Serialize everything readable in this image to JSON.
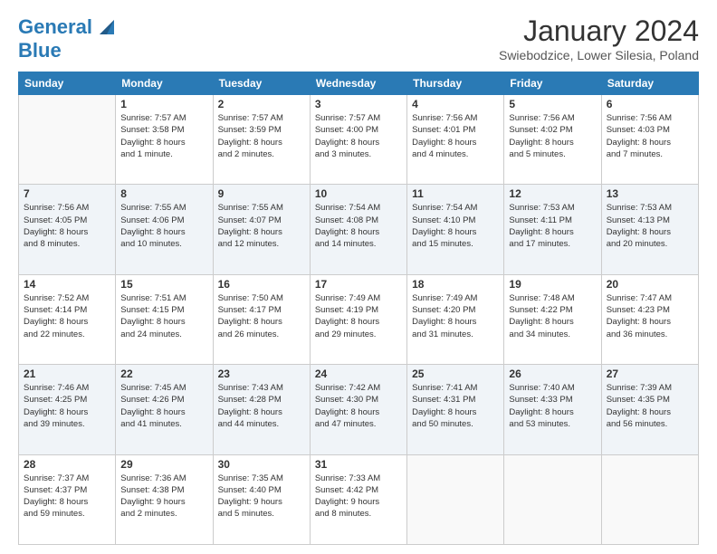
{
  "header": {
    "logo_line1": "General",
    "logo_line2": "Blue",
    "title": "January 2024",
    "subtitle": "Swiebodzice, Lower Silesia, Poland"
  },
  "days_of_week": [
    "Sunday",
    "Monday",
    "Tuesday",
    "Wednesday",
    "Thursday",
    "Friday",
    "Saturday"
  ],
  "weeks": [
    [
      {
        "day": "",
        "info": ""
      },
      {
        "day": "1",
        "info": "Sunrise: 7:57 AM\nSunset: 3:58 PM\nDaylight: 8 hours\nand 1 minute."
      },
      {
        "day": "2",
        "info": "Sunrise: 7:57 AM\nSunset: 3:59 PM\nDaylight: 8 hours\nand 2 minutes."
      },
      {
        "day": "3",
        "info": "Sunrise: 7:57 AM\nSunset: 4:00 PM\nDaylight: 8 hours\nand 3 minutes."
      },
      {
        "day": "4",
        "info": "Sunrise: 7:56 AM\nSunset: 4:01 PM\nDaylight: 8 hours\nand 4 minutes."
      },
      {
        "day": "5",
        "info": "Sunrise: 7:56 AM\nSunset: 4:02 PM\nDaylight: 8 hours\nand 5 minutes."
      },
      {
        "day": "6",
        "info": "Sunrise: 7:56 AM\nSunset: 4:03 PM\nDaylight: 8 hours\nand 7 minutes."
      }
    ],
    [
      {
        "day": "7",
        "info": "Sunrise: 7:56 AM\nSunset: 4:05 PM\nDaylight: 8 hours\nand 8 minutes."
      },
      {
        "day": "8",
        "info": "Sunrise: 7:55 AM\nSunset: 4:06 PM\nDaylight: 8 hours\nand 10 minutes."
      },
      {
        "day": "9",
        "info": "Sunrise: 7:55 AM\nSunset: 4:07 PM\nDaylight: 8 hours\nand 12 minutes."
      },
      {
        "day": "10",
        "info": "Sunrise: 7:54 AM\nSunset: 4:08 PM\nDaylight: 8 hours\nand 14 minutes."
      },
      {
        "day": "11",
        "info": "Sunrise: 7:54 AM\nSunset: 4:10 PM\nDaylight: 8 hours\nand 15 minutes."
      },
      {
        "day": "12",
        "info": "Sunrise: 7:53 AM\nSunset: 4:11 PM\nDaylight: 8 hours\nand 17 minutes."
      },
      {
        "day": "13",
        "info": "Sunrise: 7:53 AM\nSunset: 4:13 PM\nDaylight: 8 hours\nand 20 minutes."
      }
    ],
    [
      {
        "day": "14",
        "info": "Sunrise: 7:52 AM\nSunset: 4:14 PM\nDaylight: 8 hours\nand 22 minutes."
      },
      {
        "day": "15",
        "info": "Sunrise: 7:51 AM\nSunset: 4:15 PM\nDaylight: 8 hours\nand 24 minutes."
      },
      {
        "day": "16",
        "info": "Sunrise: 7:50 AM\nSunset: 4:17 PM\nDaylight: 8 hours\nand 26 minutes."
      },
      {
        "day": "17",
        "info": "Sunrise: 7:49 AM\nSunset: 4:19 PM\nDaylight: 8 hours\nand 29 minutes."
      },
      {
        "day": "18",
        "info": "Sunrise: 7:49 AM\nSunset: 4:20 PM\nDaylight: 8 hours\nand 31 minutes."
      },
      {
        "day": "19",
        "info": "Sunrise: 7:48 AM\nSunset: 4:22 PM\nDaylight: 8 hours\nand 34 minutes."
      },
      {
        "day": "20",
        "info": "Sunrise: 7:47 AM\nSunset: 4:23 PM\nDaylight: 8 hours\nand 36 minutes."
      }
    ],
    [
      {
        "day": "21",
        "info": "Sunrise: 7:46 AM\nSunset: 4:25 PM\nDaylight: 8 hours\nand 39 minutes."
      },
      {
        "day": "22",
        "info": "Sunrise: 7:45 AM\nSunset: 4:26 PM\nDaylight: 8 hours\nand 41 minutes."
      },
      {
        "day": "23",
        "info": "Sunrise: 7:43 AM\nSunset: 4:28 PM\nDaylight: 8 hours\nand 44 minutes."
      },
      {
        "day": "24",
        "info": "Sunrise: 7:42 AM\nSunset: 4:30 PM\nDaylight: 8 hours\nand 47 minutes."
      },
      {
        "day": "25",
        "info": "Sunrise: 7:41 AM\nSunset: 4:31 PM\nDaylight: 8 hours\nand 50 minutes."
      },
      {
        "day": "26",
        "info": "Sunrise: 7:40 AM\nSunset: 4:33 PM\nDaylight: 8 hours\nand 53 minutes."
      },
      {
        "day": "27",
        "info": "Sunrise: 7:39 AM\nSunset: 4:35 PM\nDaylight: 8 hours\nand 56 minutes."
      }
    ],
    [
      {
        "day": "28",
        "info": "Sunrise: 7:37 AM\nSunset: 4:37 PM\nDaylight: 8 hours\nand 59 minutes."
      },
      {
        "day": "29",
        "info": "Sunrise: 7:36 AM\nSunset: 4:38 PM\nDaylight: 9 hours\nand 2 minutes."
      },
      {
        "day": "30",
        "info": "Sunrise: 7:35 AM\nSunset: 4:40 PM\nDaylight: 9 hours\nand 5 minutes."
      },
      {
        "day": "31",
        "info": "Sunrise: 7:33 AM\nSunset: 4:42 PM\nDaylight: 9 hours\nand 8 minutes."
      },
      {
        "day": "",
        "info": ""
      },
      {
        "day": "",
        "info": ""
      },
      {
        "day": "",
        "info": ""
      }
    ]
  ]
}
